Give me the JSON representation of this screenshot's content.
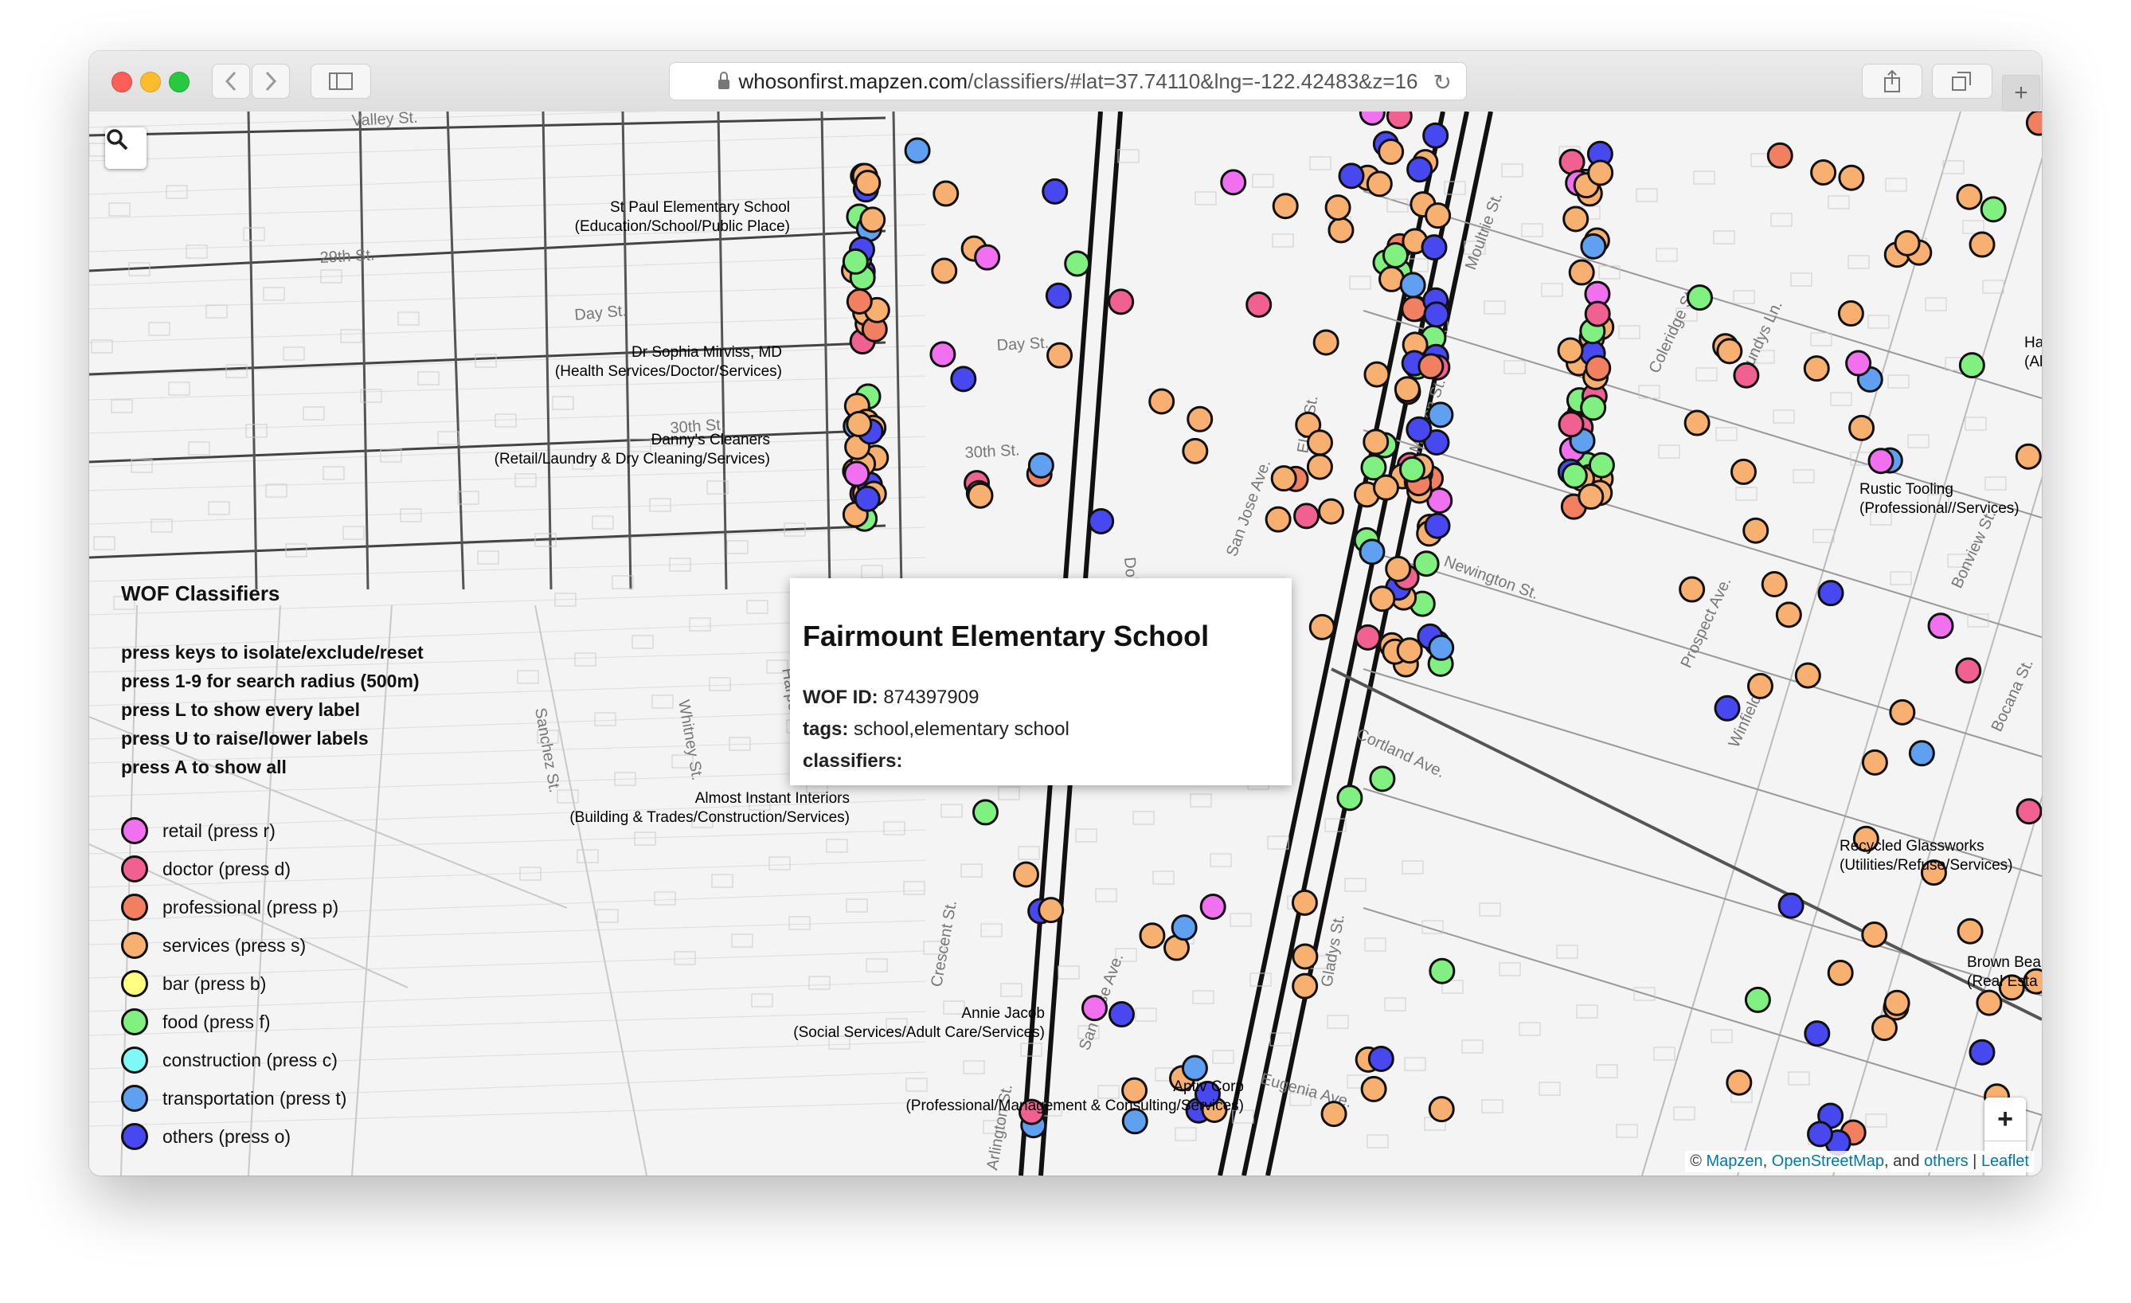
{
  "browser": {
    "url_host": "whosonfirst.mapzen.com",
    "url_path": "/classifiers/#lat=37.74110&lng=-122.42483&z=16"
  },
  "legend": {
    "title": "WOF Classifiers",
    "instructions": [
      "press keys to isolate/exclude/reset",
      "press 1-9 for search radius (500m)",
      "press L to show every label",
      "press U to raise/lower labels",
      "press A to show all"
    ],
    "categories": [
      {
        "label": "retail (press r)",
        "color": "#f070f0"
      },
      {
        "label": "doctor (press d)",
        "color": "#f06090"
      },
      {
        "label": "professional (press p)",
        "color": "#f08060"
      },
      {
        "label": "services (press s)",
        "color": "#f8b070"
      },
      {
        "label": "bar (press b)",
        "color": "#ffff80"
      },
      {
        "label": "food (press f)",
        "color": "#80f080"
      },
      {
        "label": "construction (press c)",
        "color": "#80f8f8"
      },
      {
        "label": "transportation (press t)",
        "color": "#60a0f0"
      },
      {
        "label": "others (press o)",
        "color": "#4848f0"
      }
    ]
  },
  "popup": {
    "title": "Fairmount Elementary School",
    "wof_id_label": "WOF ID:",
    "wof_id": "874397909",
    "tags_label": "tags:",
    "tags": "school,elementary school",
    "classifiers_label": "classifiers:"
  },
  "streets": [
    "Valley St.",
    "29th St.",
    "Day St.",
    "Day St.",
    "30th St.",
    "30th St.",
    "Sanchez St.",
    "Whitney St.",
    "Harper St.",
    "Dolores St.",
    "San Jose Ave.",
    "San Jose Ave.",
    "Cortland Ave.",
    "Coleridge St.",
    "Lundys Ln.",
    "Prospect Ave.",
    "Winfield St.",
    "Bonview St.",
    "Bocana St.",
    "Arlington St.",
    "Crescent St.",
    "Gladys St.",
    "Elsie St.",
    "Eugenia Ave.",
    "Newington St.",
    "Mission St.",
    "Moultrie St."
  ],
  "poi_labels": [
    {
      "name": "St Paul Elementary School",
      "category": "(Education/School/Public Place)"
    },
    {
      "name": "Dr Sophia Mirviss, MD",
      "category": "(Health Services/Doctor/Services)"
    },
    {
      "name": "Danny's Cleaners",
      "category": "(Retail/Laundry & Dry Cleaning/Services)"
    },
    {
      "name": "Almost Instant Interiors",
      "category": "(Building & Trades/Construction/Services)"
    },
    {
      "name": "Annie Jacob",
      "category": "(Social Services/Adult Care/Services)"
    },
    {
      "name": "Aptiv Corp",
      "category": "(Professional/Management & Consulting/Services)"
    },
    {
      "name": "Rustic Tooling",
      "category": "(Professional//Services)"
    },
    {
      "name": "Recycled Glassworks",
      "category": "(Utilities/Refuse/Services)"
    },
    {
      "name": "Brown Bea",
      "category": "(Real Esta"
    },
    {
      "name": "Ha",
      "category": "(Al"
    }
  ],
  "zoom": {
    "in_label": "+",
    "out_label": "−"
  },
  "attribution": {
    "prefix": "© ",
    "mapzen": "Mapzen",
    "sep1": ", ",
    "osm": "OpenStreetMap",
    "sep2": ", and ",
    "others": "others",
    "sep3": " | ",
    "leaflet": "Leaflet"
  },
  "icons": {
    "search": "search-icon",
    "back": "chevron-left-icon",
    "forward": "chevron-right-icon",
    "sidebar": "sidebar-icon",
    "share": "share-icon",
    "tabs": "tabs-icon",
    "new_tab": "plus-icon",
    "reload": "reload-icon",
    "lock": "lock-icon"
  }
}
